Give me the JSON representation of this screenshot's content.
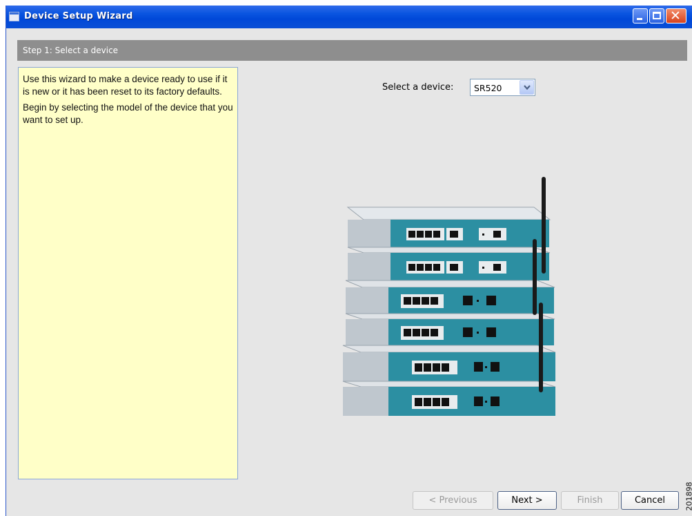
{
  "window": {
    "title": "Device Setup Wizard"
  },
  "step": {
    "header": "Step 1: Select a device"
  },
  "help": {
    "paragraphs": [
      "Use this wizard to make a device ready to use if it is new or it has been reset to its factory defaults.",
      "Begin by selecting the model of the device that you want to set up."
    ]
  },
  "device_selector": {
    "label": "Select a device:",
    "selected": "SR520"
  },
  "buttons": {
    "previous": "< Previous",
    "next": "Next >",
    "finish": "Finish",
    "cancel": "Cancel"
  },
  "figure_code": "201898",
  "icons": {
    "app": "window-icon",
    "minimize": "minimize-icon",
    "maximize": "maximize-icon",
    "close": "close-icon",
    "dropdown": "chevron-down-icon"
  },
  "colors": {
    "titlebar": "#0a55e0",
    "step_header": "#8e8e8e",
    "help_panel": "#ffffc8",
    "device_body": "#2c8fa2"
  }
}
